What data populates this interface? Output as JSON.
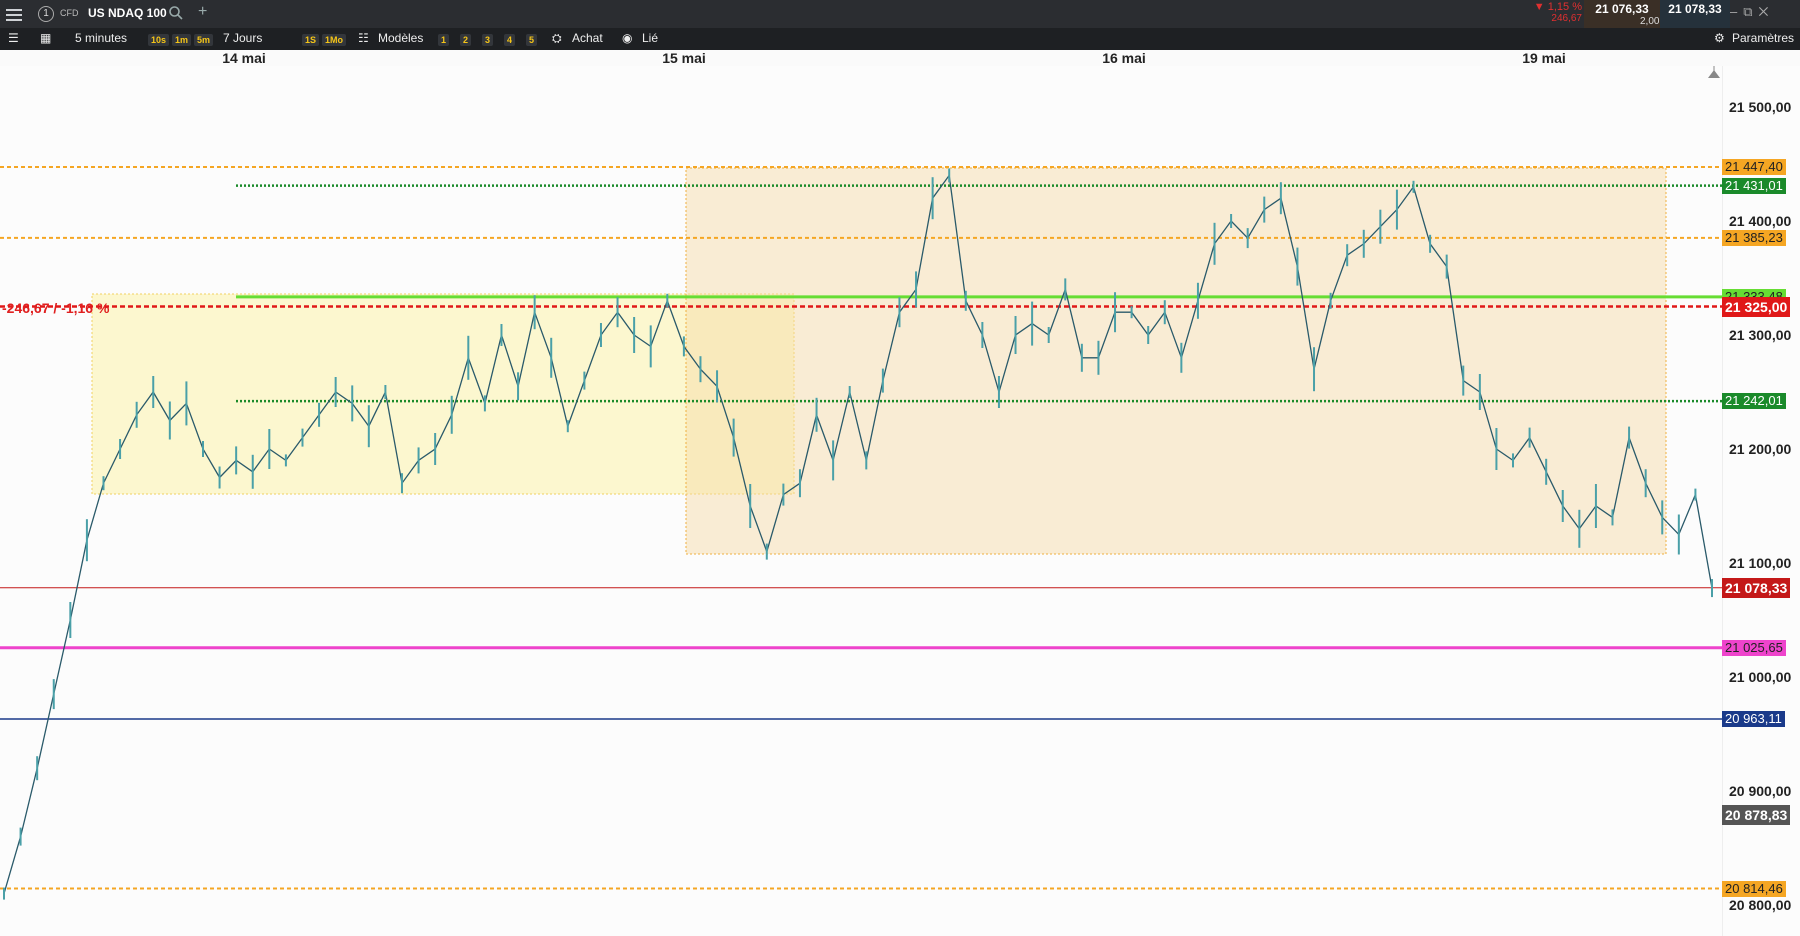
{
  "instrument": {
    "type_label": "CFD",
    "name": "US NDAQ 100",
    "index": "1"
  },
  "quote": {
    "change_pct": "▼ 1,15 %",
    "change_abs": "246,67",
    "bid": "21 076,33",
    "ask": "21 078,33",
    "spread": "2,00"
  },
  "toolbar": {
    "interval": "5 minutes",
    "quick_intervals": [
      "10s",
      "1m",
      "5m"
    ],
    "range": "7 Jours",
    "quick_ranges": [
      "1S",
      "1Mo"
    ],
    "templates_label": "Modèles",
    "layout_buttons": [
      "1",
      "2",
      "3",
      "4",
      "5"
    ],
    "buy_label": "Achat",
    "linked_label": "Lié",
    "settings_label": "Paramètres"
  },
  "xaxis": {
    "labels": [
      "14 mai",
      "15 mai",
      "16 mai",
      "19 mai"
    ]
  },
  "yaxis": {
    "ticks": [
      "21 500,00",
      "21 400,00",
      "21 300,00",
      "21 200,00",
      "21 100,00",
      "21 000,00",
      "20 900,00",
      "20 800,00"
    ]
  },
  "levels": [
    {
      "label": "21 447,40",
      "price": 21447.4,
      "color": "#f5a623",
      "style": "dashed"
    },
    {
      "label": "21 431,01",
      "price": 21431.01,
      "color": "#1a8a2a",
      "style": "dotted"
    },
    {
      "label": "21 385,23",
      "price": 21385.23,
      "color": "#f5a623",
      "style": "dashed"
    },
    {
      "label": "21 333,48",
      "price": 21333.48,
      "color": "#66dd33",
      "style": "solid"
    },
    {
      "label": "21 325,00",
      "price": 21325.0,
      "color": "#e01818",
      "style": "dashed-red"
    },
    {
      "label": "21 242,01",
      "price": 21242.01,
      "color": "#1a8a2a",
      "style": "dotted"
    },
    {
      "label": "21 078,33",
      "price": 21078.33,
      "color": "#c41818",
      "style": "current"
    },
    {
      "label": "21 025,65",
      "price": 21025.65,
      "color": "#ee44cc",
      "style": "solid"
    },
    {
      "label": "20 963,11",
      "price": 20963.11,
      "color": "#1a3a8a",
      "style": "solid"
    },
    {
      "label": "20 878,83",
      "price": 20878.83,
      "color": "#555555",
      "style": "marker"
    },
    {
      "label": "20 814,46",
      "price": 20814.46,
      "color": "#f5a623",
      "style": "dashed"
    }
  ],
  "drawdown_label": "-246,67 / -1,16 %",
  "chart_data": {
    "type": "line",
    "title": "",
    "ylim": [
      20790,
      21540
    ],
    "x": [
      "14 mai",
      "15 mai",
      "16 mai",
      "19 mai"
    ],
    "series": [
      {
        "values": [
          20810,
          20860,
          20920,
          20985,
          21050,
          21120,
          21170,
          21200,
          21230,
          21250,
          21225,
          21240,
          21200,
          21175,
          21190,
          21180,
          21200,
          21190,
          21210,
          21230,
          21250,
          21240,
          21220,
          21250,
          21170,
          21190,
          21200,
          21230,
          21280,
          21240,
          21300,
          21255,
          21320,
          21280,
          21220,
          21260,
          21300,
          21320,
          21300,
          21290,
          21330,
          21290,
          21270,
          21255,
          21210,
          21150,
          21110,
          21160,
          21170,
          21230,
          21190,
          21250,
          21190,
          21260,
          21320,
          21340,
          21420,
          21440,
          21330,
          21300,
          21250,
          21300,
          21310,
          21300,
          21340,
          21280,
          21280,
          21320,
          21320,
          21300,
          21320,
          21280,
          21330,
          21380,
          21400,
          21385,
          21410,
          21420,
          21360,
          21270,
          21330,
          21370,
          21380,
          21395,
          21410,
          21430,
          21380,
          21360,
          21260,
          21250,
          21200,
          21190,
          21210,
          21180,
          21150,
          21130,
          21150,
          21140,
          21210,
          21170,
          21140,
          21125,
          21160,
          21078
        ]
      }
    ]
  }
}
